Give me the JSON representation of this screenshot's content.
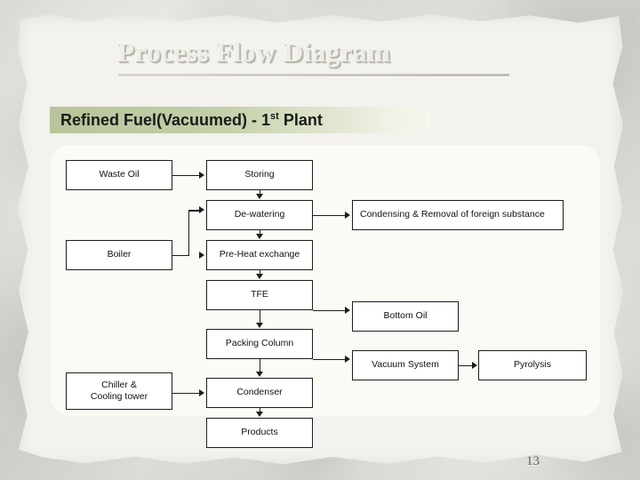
{
  "slide": {
    "title": "Process Flow Diagram",
    "banner": {
      "prefix": "Refined Fuel(Vacuumed)  - 1",
      "superscript": "st",
      "suffix": " Plant"
    },
    "slide_number": "13",
    "colors": {
      "banner_start": "#b8c49a",
      "banner_end": "#f5f6ef",
      "panel": "#fbfaf5",
      "box_border": "#1d1d1d",
      "title_text": "#efeee6",
      "background": "#d2d0ca"
    }
  },
  "diagram": {
    "nodes": [
      {
        "id": "waste-oil",
        "label": "Waste Oil"
      },
      {
        "id": "storing",
        "label": "Storing"
      },
      {
        "id": "de-watering",
        "label": "De-watering"
      },
      {
        "id": "condensing-removal",
        "label": "Condensing & Removal of foreign substance"
      },
      {
        "id": "boiler",
        "label": "Boiler"
      },
      {
        "id": "pre-heat-exchange",
        "label": "Pre-Heat exchange"
      },
      {
        "id": "tfe",
        "label": "TFE"
      },
      {
        "id": "bottom-oil",
        "label": "Bottom Oil"
      },
      {
        "id": "packing-column",
        "label": "Packing Column"
      },
      {
        "id": "vacuum-system",
        "label": "Vacuum System"
      },
      {
        "id": "pyrolysis",
        "label": "Pyrolysis"
      },
      {
        "id": "chiller-cooling-tower-line1",
        "label": "Chiller &"
      },
      {
        "id": "chiller-cooling-tower-line2",
        "label": "Cooling tower"
      },
      {
        "id": "condenser",
        "label": "Condenser"
      },
      {
        "id": "products",
        "label": "Products"
      }
    ]
  }
}
